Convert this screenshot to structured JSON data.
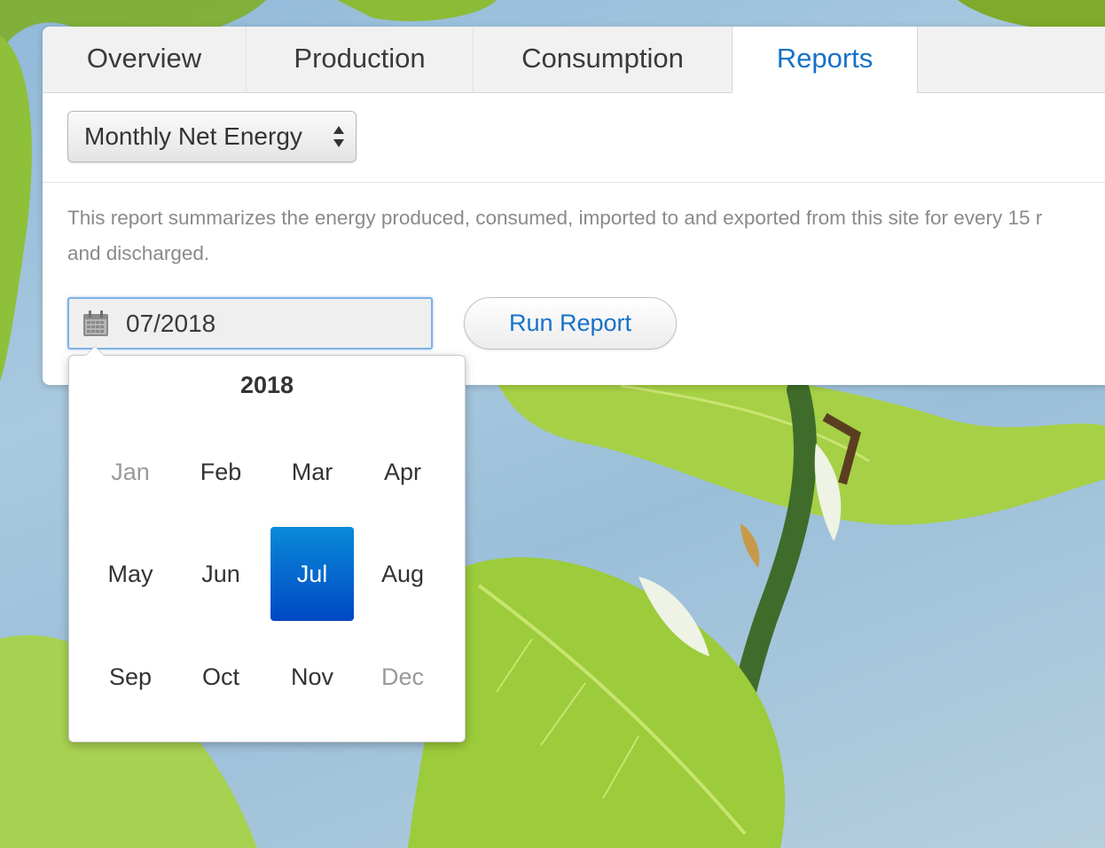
{
  "tabs": [
    {
      "label": "Overview",
      "active": false
    },
    {
      "label": "Production",
      "active": false
    },
    {
      "label": "Consumption",
      "active": false
    },
    {
      "label": "Reports",
      "active": true
    }
  ],
  "report_select": {
    "value": "Monthly Net Energy",
    "icon": "updown-arrows-icon"
  },
  "description": {
    "line1": "This report summarizes the energy produced, consumed, imported to and exported from this site for every 15 r",
    "line2": "and discharged."
  },
  "date_input": {
    "value": "07/2018",
    "icon": "calendar-icon"
  },
  "run_button": {
    "label": "Run Report"
  },
  "month_picker": {
    "year": "2018",
    "months": [
      {
        "label": "Jan",
        "state": "disabled"
      },
      {
        "label": "Feb",
        "state": "normal"
      },
      {
        "label": "Mar",
        "state": "normal"
      },
      {
        "label": "Apr",
        "state": "normal"
      },
      {
        "label": "May",
        "state": "normal"
      },
      {
        "label": "Jun",
        "state": "normal"
      },
      {
        "label": "Jul",
        "state": "selected"
      },
      {
        "label": "Aug",
        "state": "normal"
      },
      {
        "label": "Sep",
        "state": "normal"
      },
      {
        "label": "Oct",
        "state": "normal"
      },
      {
        "label": "Nov",
        "state": "normal"
      },
      {
        "label": "Dec",
        "state": "disabled"
      }
    ]
  },
  "colors": {
    "accent": "#1672c9",
    "selected_month": "#0048c4",
    "muted_text": "#8a8a8a"
  }
}
